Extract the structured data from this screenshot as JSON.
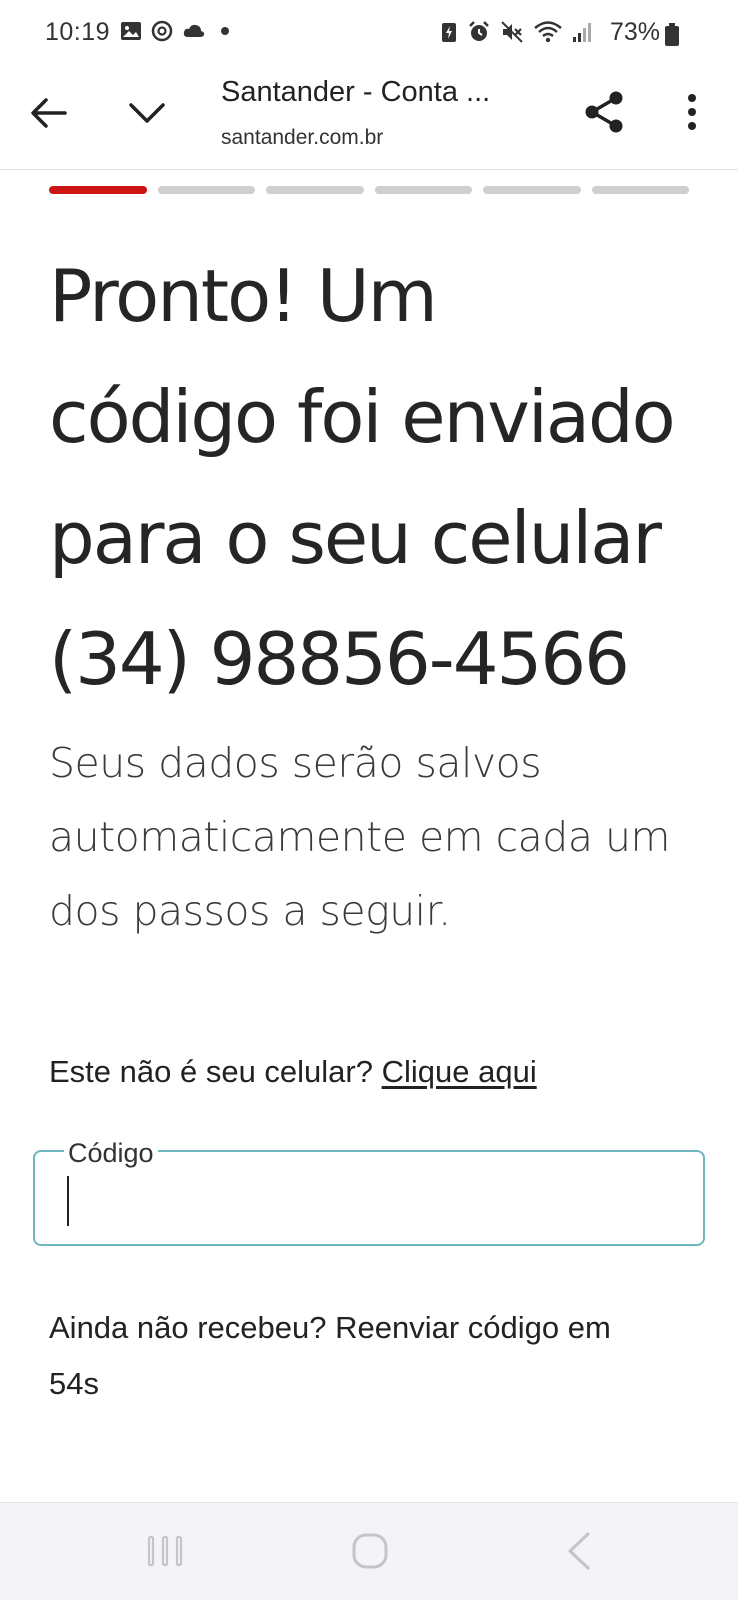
{
  "status_bar": {
    "time": "10:19",
    "battery": "73%",
    "left_icons": [
      "gallery-icon",
      "threads-icon",
      "cloud-icon",
      "dot-icon"
    ],
    "right_icons": [
      "battery-saver-icon",
      "alarm-icon",
      "mute-icon",
      "wifi-icon",
      "signal-icon"
    ]
  },
  "browser": {
    "title": "Santander - Conta ...",
    "url": "santander.com.br"
  },
  "progress": {
    "total_steps": 6,
    "current_step": 1,
    "active_color": "#cc1414",
    "inactive_color": "#cfcfcf"
  },
  "content": {
    "headline_lines": [
      "Pronto! Um",
      "código foi enviado",
      "para o seu celular",
      "(34) 98856-4566"
    ],
    "subtitle_lines": [
      "Seus dados serão salvos",
      "automaticamente em cada um",
      "dos passos a seguir."
    ],
    "not_your_phone_text": "Este não é seu celular?",
    "not_your_phone_link": "Clique aqui",
    "code_label": "Código",
    "code_value": "",
    "resend_lines": [
      "Ainda não recebeu? Reenviar código em",
      "54s"
    ]
  },
  "colors": {
    "field_border": "#6fb6c0",
    "brand_red": "#cc1414"
  }
}
